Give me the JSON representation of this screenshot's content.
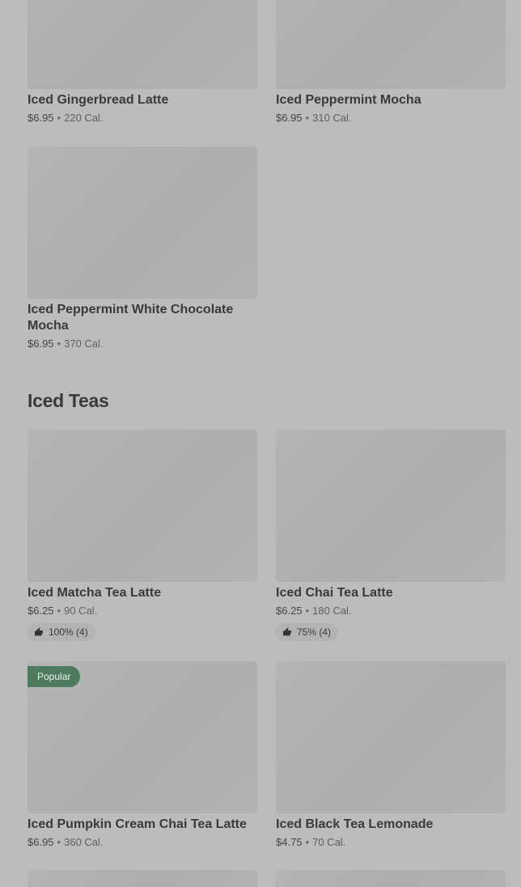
{
  "items_top": [
    {
      "name": "Iced Gingerbread Latte",
      "price": "$6.95",
      "sep": "•",
      "cal": "220 Cal."
    },
    {
      "name": "Iced Peppermint Mocha",
      "price": "$6.95",
      "sep": "•",
      "cal": "310 Cal."
    },
    {
      "name": "Iced Peppermint White Chocolate Mocha",
      "price": "$6.95",
      "sep": "•",
      "cal": "370 Cal."
    }
  ],
  "section": {
    "title": "Iced Teas"
  },
  "items_teas": [
    {
      "name": "Iced Matcha Tea Latte",
      "price": "$6.25",
      "sep": "•",
      "cal": "90 Cal.",
      "rating": "100% (4)"
    },
    {
      "name": "Iced Chai Tea Latte",
      "price": "$6.25",
      "sep": "•",
      "cal": "180 Cal.",
      "rating": "75% (4)"
    },
    {
      "name": "Iced Pumpkin Cream Chai Tea Latte",
      "price": "$6.95",
      "sep": "•",
      "cal": "360 Cal.",
      "badge": "Popular"
    },
    {
      "name": "Iced Black Tea Lemonade",
      "price": "$4.75",
      "sep": "•",
      "cal": "70 Cal."
    }
  ],
  "icons": {
    "rating": "thumbs-up-icon"
  },
  "colors": {
    "badge_bg": "#4e7a5e",
    "page_bg": "#bcbcbc"
  }
}
